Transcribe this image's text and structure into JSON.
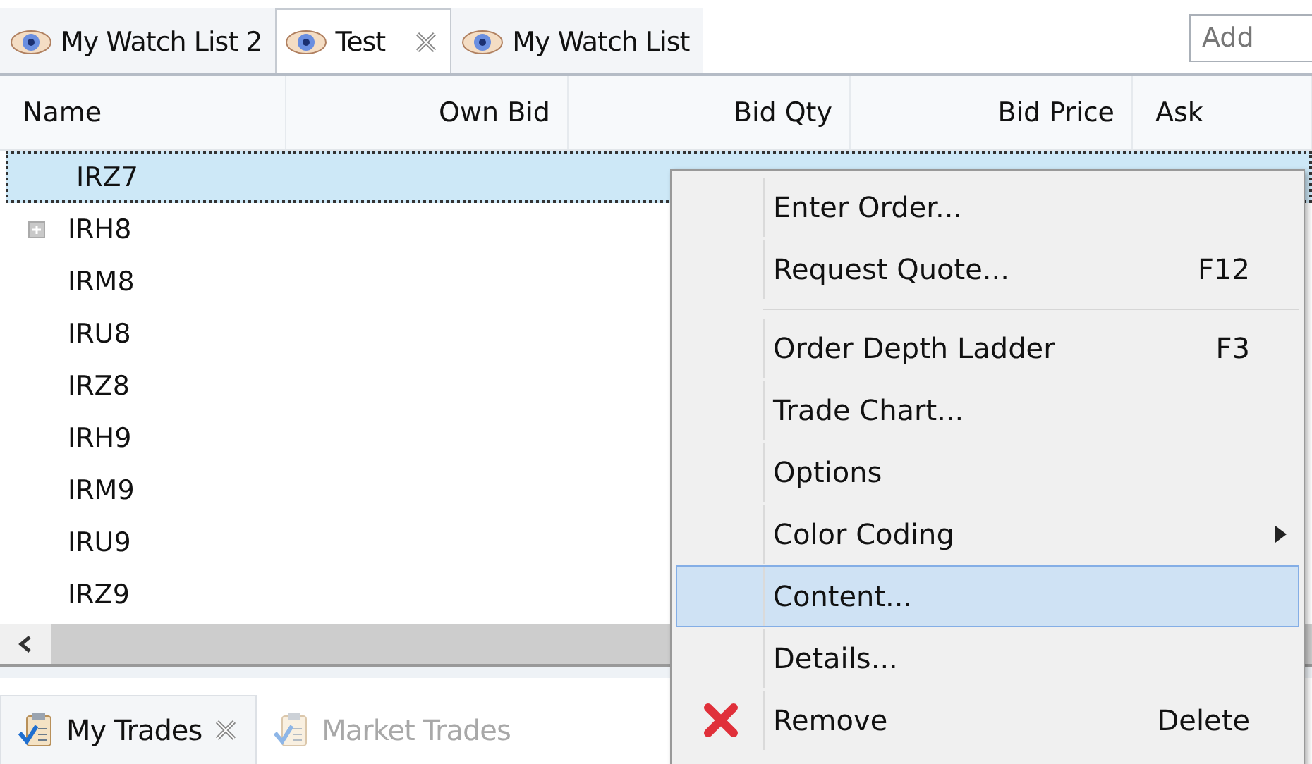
{
  "watch_tabs": [
    {
      "label": "My Watch List 2",
      "selected": false,
      "closable": false
    },
    {
      "label": "Test",
      "selected": true,
      "closable": true
    },
    {
      "label": "My Watch List",
      "selected": false,
      "closable": false
    }
  ],
  "add_field": {
    "placeholder": "Add"
  },
  "table": {
    "columns": [
      "Name",
      "Own Bid",
      "Bid Qty",
      "Bid Price",
      "Ask"
    ],
    "rows": [
      {
        "name": "IRZ7",
        "selected": true,
        "collapsed": false
      },
      {
        "name": "IRH8",
        "selected": false,
        "collapsed": true
      },
      {
        "name": "IRM8",
        "selected": false,
        "collapsed": false
      },
      {
        "name": "IRU8",
        "selected": false,
        "collapsed": false
      },
      {
        "name": "IRZ8",
        "selected": false,
        "collapsed": false
      },
      {
        "name": "IRH9",
        "selected": false,
        "collapsed": false
      },
      {
        "name": "IRM9",
        "selected": false,
        "collapsed": false
      },
      {
        "name": "IRU9",
        "selected": false,
        "collapsed": false
      },
      {
        "name": "IRZ9",
        "selected": false,
        "collapsed": false
      }
    ]
  },
  "bottom_tabs": [
    {
      "label": "My Trades",
      "selected": true,
      "closable": true
    },
    {
      "label": "Market Trades",
      "selected": false,
      "closable": false
    }
  ],
  "context_menu": {
    "items": [
      {
        "kind": "item",
        "label": "Enter Order...",
        "selected": false
      },
      {
        "kind": "item",
        "label": "Request Quote...",
        "shortcut": "F12",
        "selected": false
      },
      {
        "kind": "separator"
      },
      {
        "kind": "item",
        "label": "Order Depth Ladder",
        "shortcut": "F3",
        "selected": false
      },
      {
        "kind": "item",
        "label": "Trade Chart...",
        "selected": false
      },
      {
        "kind": "item",
        "label": "Options",
        "selected": false
      },
      {
        "kind": "submenu",
        "label": "Color Coding",
        "selected": false
      },
      {
        "kind": "item",
        "label": "Content...",
        "selected": true
      },
      {
        "kind": "item",
        "label": "Details...",
        "selected": false
      },
      {
        "kind": "delete",
        "label": "Remove",
        "shortcut": "Delete",
        "selected": false
      }
    ]
  }
}
